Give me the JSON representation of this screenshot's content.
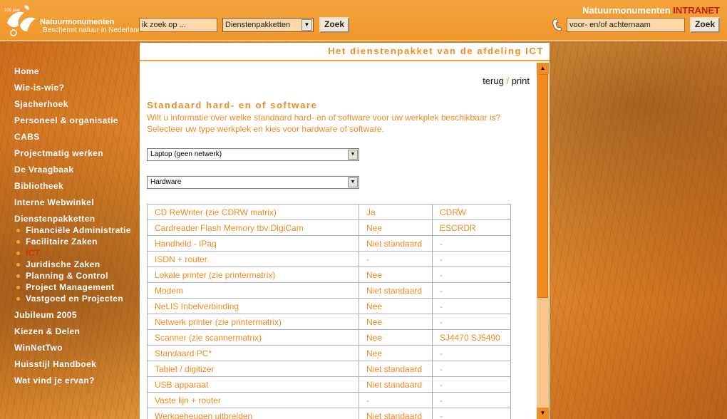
{
  "header": {
    "logo_badge": "100 jaar",
    "org_name": "Natuurmonumenten",
    "tagline": "Beschermt natuur in Nederland",
    "search_value": "ik zoek op ...",
    "category_select": "Dienstenpakketten",
    "search_button": "Zoek",
    "intranet_name": "Natuurmonumenten",
    "intranet_suffix": "INTRANET",
    "person_value": "voor- en/of achternaam",
    "person_button": "Zoek"
  },
  "sidebar": {
    "items": [
      {
        "label": "Home"
      },
      {
        "label": "Wie-is-wie?"
      },
      {
        "label": "Sjacherhoek"
      },
      {
        "label": "Personeel & organisatie"
      },
      {
        "label": "CABS"
      },
      {
        "label": "Projectmatig werken"
      },
      {
        "label": "De Vraagbaak"
      },
      {
        "label": "Bibliotheek"
      },
      {
        "label": "Interne Webwinkel"
      },
      {
        "label": "Dienstenpakketten"
      }
    ],
    "subitems": [
      {
        "label": "Financiële Administratie"
      },
      {
        "label": "Facilitaire Zaken"
      },
      {
        "label": "ICT"
      },
      {
        "label": "Juridische Zaken"
      },
      {
        "label": "Planning & Control"
      },
      {
        "label": "Project Management"
      },
      {
        "label": "Vastgoed en Projecten"
      }
    ],
    "items_after": [
      {
        "label": "Jubileum 2005"
      },
      {
        "label": "Kiezen & Delen"
      },
      {
        "label": "WinNetTwo"
      },
      {
        "label": "Huisstijl Handboek"
      },
      {
        "label": "Wat vind je ervan?"
      }
    ]
  },
  "main": {
    "page_title": "Het dienstenpakket van de afdeling ICT",
    "link_back": "terug",
    "link_sep": "/",
    "link_print": "print",
    "section_title": "Standaard hard- en of software",
    "intro_line1": "Wilt u informatie over welke standaard hard- en of software voor uw werkplek beschikbaar is?",
    "intro_line2": "Selecteer uw type werkplek en kies voor hardware of software.",
    "workplace_select": "Laptop (geen netwerk)",
    "type_select": "Hardware",
    "rows": [
      {
        "item": "CD ReWriter (zie CDRW matrix)",
        "standard": "Ja",
        "code": "CDRW"
      },
      {
        "item": "Cardreader Flash Memory tbv DigiCam",
        "standard": "Nee",
        "code": "ESCRDR"
      },
      {
        "item": "Handheld - IPaq",
        "standard": "Niet standaard",
        "code": "-"
      },
      {
        "item": "ISDN + router",
        "standard": "-",
        "code": "-"
      },
      {
        "item": "Lokale printer (zie printermatrix)",
        "standard": "Nee",
        "code": "-"
      },
      {
        "item": "Modem",
        "standard": "Niet standaard",
        "code": "-"
      },
      {
        "item": "NeLIS Inbelverbinding",
        "standard": "Nee",
        "code": "-"
      },
      {
        "item": "Netwerk printer (zie printermatrix)",
        "standard": "Nee",
        "code": "-"
      },
      {
        "item": "Scanner (zie scannermatrix)",
        "standard": "Nee",
        "code": "SJ4470 SJ5490"
      },
      {
        "item": "Standaard PC*",
        "standard": "Nee",
        "code": "-"
      },
      {
        "item": "Tablet / digitizer",
        "standard": "Niet standaard",
        "code": "-"
      },
      {
        "item": "USB apparaat",
        "standard": "Niet standaard",
        "code": "-"
      },
      {
        "item": "Vaste lijn + router",
        "standard": "-",
        "code": "-"
      },
      {
        "item": "Werkgeheugen uitbreiden",
        "standard": "Niet standaard",
        "code": "-"
      }
    ]
  },
  "colors": {
    "accent": "#f18b22",
    "header_bg": "#f4a33c",
    "active_nav": "#d9300e",
    "intranet_red": "#c81e0b"
  }
}
